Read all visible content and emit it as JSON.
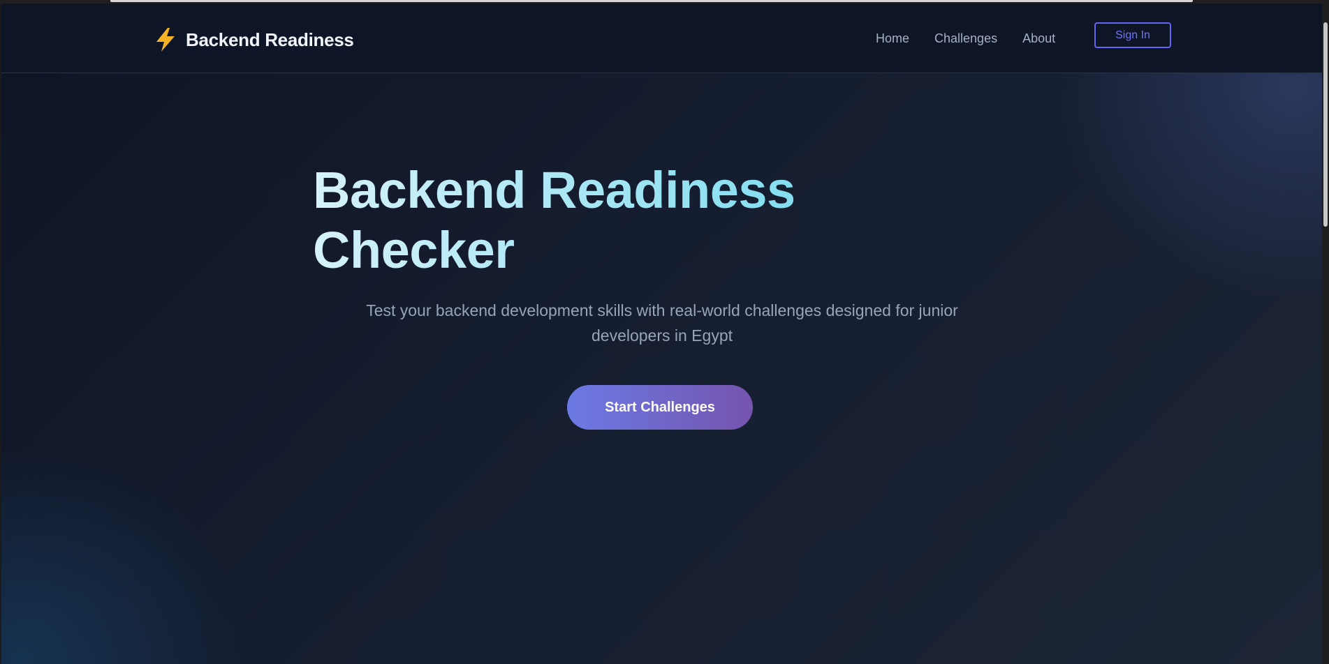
{
  "navbar": {
    "brand_icon": "lightning-bolt-icon",
    "brand_name": "Backend Readiness",
    "links": [
      {
        "label": "Home"
      },
      {
        "label": "Challenges"
      },
      {
        "label": "About"
      }
    ],
    "signin_label": "Sign In"
  },
  "hero": {
    "title_line1": "Backend Readiness",
    "title_line2": "Checker",
    "subtitle_line1": "Test your backend development skills with real-world challenges designed for junior",
    "subtitle_line2": "developers in Egypt",
    "cta_label": "Start Challenges"
  },
  "colors": {
    "accent": "#6366f1",
    "cta_gradient_start": "#6b7ae4",
    "cta_gradient_end": "#7554ae",
    "title_gradient_start": "#d6f2fb",
    "title_gradient_end": "#5ed6ee",
    "bolt": "#f5b324",
    "background": "#151d30"
  }
}
